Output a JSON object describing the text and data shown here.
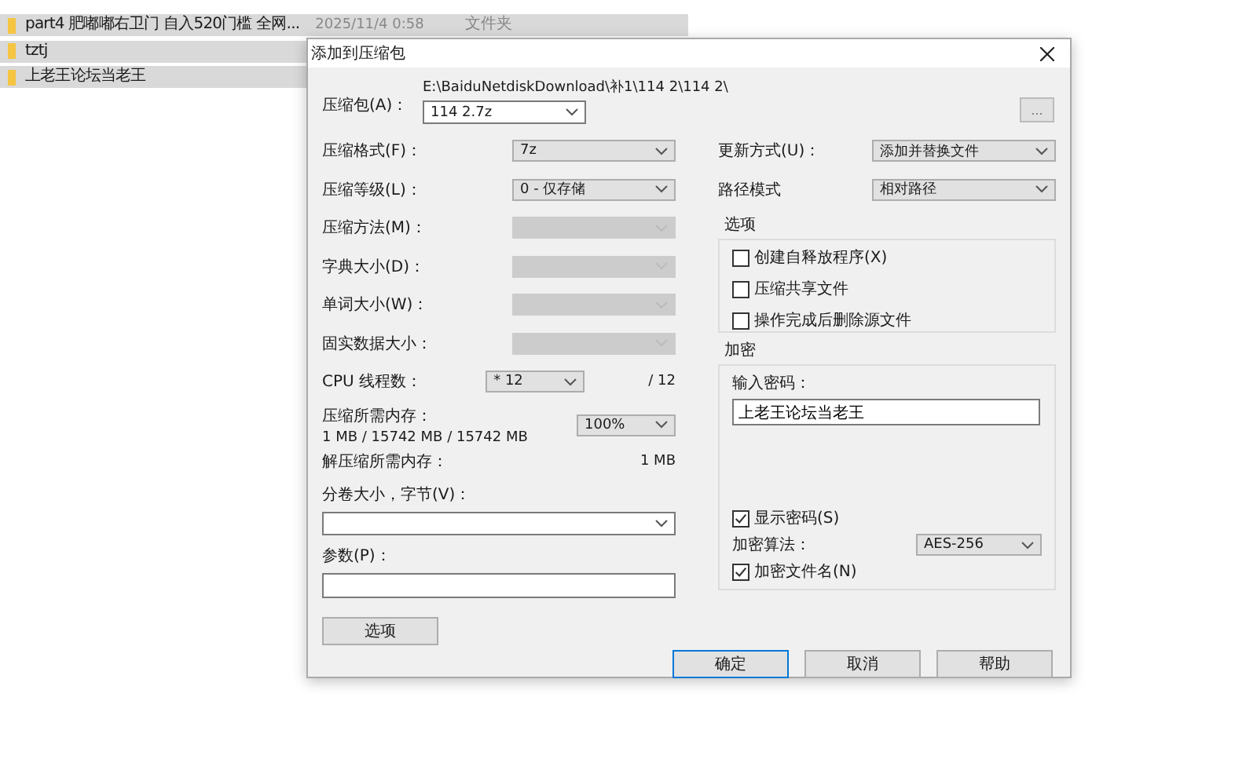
{
  "file_list": {
    "rows": [
      {
        "name": "part4 肥嘟嘟右卫门 自入520门槛 全网...",
        "date": "2025/11/4 0:58",
        "type": "文件夹"
      },
      {
        "name": "tztj"
      },
      {
        "name": "上老王论坛当老王"
      }
    ]
  },
  "dialog": {
    "title": "添加到压缩包",
    "archive": {
      "label": "压缩包(A)：",
      "path": "E:\\BaiduNetdiskDownload\\补1\\114 2\\114 2\\",
      "value": "114 2.7z",
      "browse": "..."
    },
    "left_rows": [
      {
        "kind": "select",
        "label": "压缩格式(F)：",
        "value": "7z",
        "disabled": false
      },
      {
        "kind": "select",
        "label": "压缩等级(L)：",
        "value": "0 - 仅存储",
        "disabled": false
      },
      {
        "kind": "select",
        "label": "压缩方法(M)：",
        "disabled": true
      },
      {
        "kind": "select",
        "label": "字典大小(D)：",
        "disabled": true
      },
      {
        "kind": "select",
        "label": "单词大小(W)：",
        "disabled": true
      },
      {
        "kind": "select",
        "label": "固实数据大小：",
        "disabled": true
      },
      {
        "kind": "threads",
        "label": "CPU 线程数：",
        "value": "* 12",
        "suffix": "/ 12",
        "disabled": false
      },
      {
        "kind": "memory",
        "label": "压缩所需内存：",
        "detail": "1 MB / 15742 MB / 15742 MB",
        "value": "100%",
        "disabled": false
      },
      {
        "kind": "info",
        "label": "解压缩所需内存：",
        "value": "1 MB"
      }
    ],
    "volume": {
      "label": "分卷大小，字节(V)："
    },
    "params": {
      "label": "参数(P)："
    },
    "options_button": "选项",
    "right_rows": [
      {
        "label": "更新方式(U)：",
        "value": "添加并替换文件"
      },
      {
        "label": "路径模式",
        "value": "相对路径"
      }
    ],
    "options_group": {
      "title": "选项",
      "items": [
        {
          "label": "创建自释放程序(X)",
          "checked": false
        },
        {
          "label": "压缩共享文件",
          "checked": false
        },
        {
          "label": "操作完成后删除源文件",
          "checked": false
        }
      ]
    },
    "encryption": {
      "title": "加密",
      "password_label": "输入密码：",
      "password": "上老王论坛当老王",
      "show_password": {
        "label": "显示密码(S)",
        "checked": true
      },
      "method_label": "加密算法：",
      "method": "AES-256",
      "encrypt_names": {
        "label": "加密文件名(N)",
        "checked": true
      }
    },
    "buttons": [
      {
        "label": "确定",
        "default": true
      },
      {
        "label": "取消",
        "default": false
      },
      {
        "label": "帮助",
        "default": false
      }
    ]
  }
}
